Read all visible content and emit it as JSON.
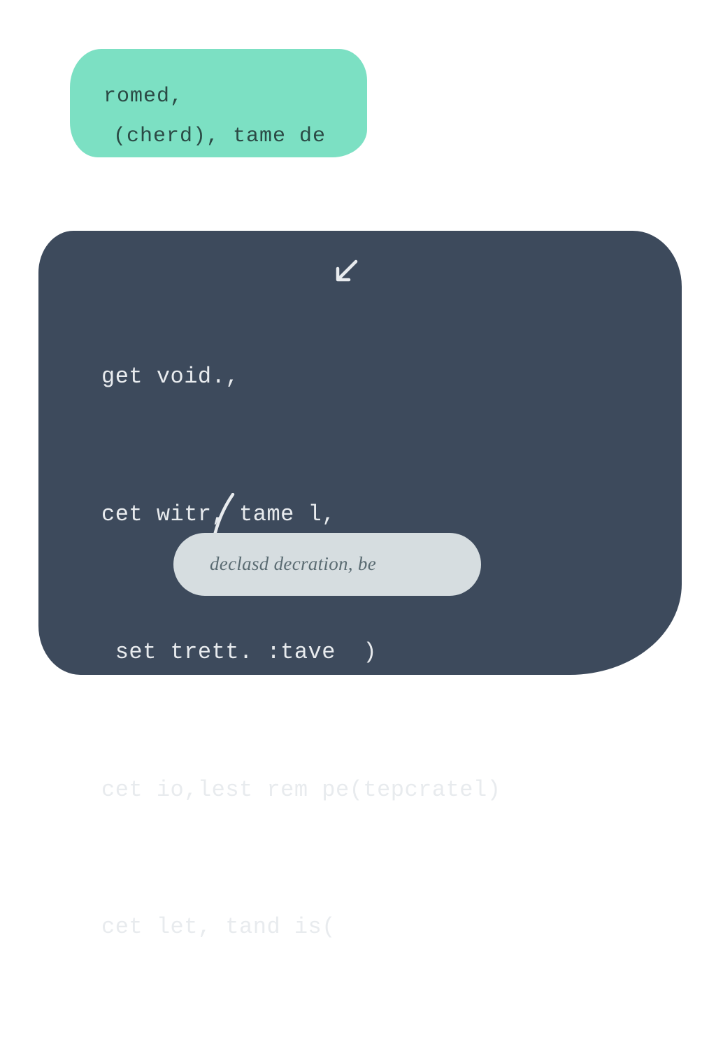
{
  "mint": {
    "line1": "romed,",
    "line2": "(cherd), tame de"
  },
  "code": {
    "line1": "get void.,",
    "line2": "cet witr, tame l,",
    "line3": " set trett. :tave  )",
    "line4": "cet io,lest rem pe(tepcratel)",
    "line5": "cet let, tand is("
  },
  "tooltip": {
    "text": "declasd decration, be"
  },
  "colors": {
    "mint_bg": "#7ce0c3",
    "mint_text": "#2b4a45",
    "dark_bg": "#3d4a5c",
    "dark_text": "#e8ebee",
    "tooltip_bg": "#d6dde0",
    "tooltip_text": "#5a6b72",
    "page_bg": "#ffffff"
  },
  "icons": {
    "arrow": "arrow-down-left-icon",
    "connector": "connector-line-icon"
  }
}
